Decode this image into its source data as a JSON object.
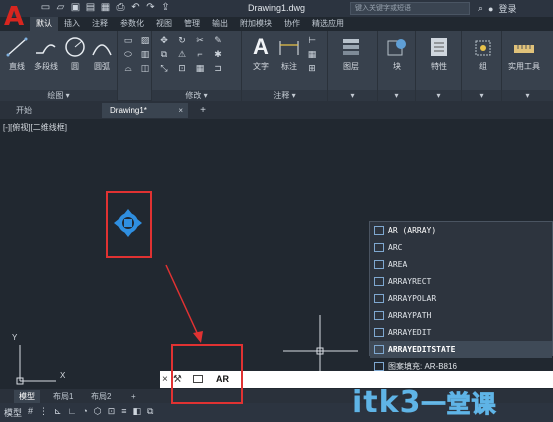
{
  "titlebar": {
    "app_logo": "A",
    "document_title": "Drawing1.dwg",
    "search_placeholder": "键入关键字或短语",
    "login_label": "登录",
    "qat_icons": [
      "new-icon",
      "open-icon",
      "save-icon",
      "saveas-icon",
      "print-icon",
      "undo-icon",
      "redo-icon"
    ]
  },
  "ribbon_tabs": [
    {
      "label": "默认",
      "active": true
    },
    {
      "label": "插入"
    },
    {
      "label": "注释"
    },
    {
      "label": "参数化"
    },
    {
      "label": "视图"
    },
    {
      "label": "管理"
    },
    {
      "label": "输出"
    },
    {
      "label": "附加模块"
    },
    {
      "label": "协作"
    },
    {
      "label": "精选应用"
    }
  ],
  "panels": {
    "draw": {
      "title": "绘图",
      "tools": [
        "直线",
        "多段线",
        "圆",
        "圆弧"
      ]
    },
    "modify": {
      "title": "修改"
    },
    "annotation": {
      "title": "注释",
      "tools": [
        "文字",
        "标注"
      ]
    },
    "layers": {
      "label": "图层"
    },
    "block": {
      "label": "块"
    },
    "properties": {
      "label": "特性"
    },
    "groups": {
      "label": "组"
    },
    "utilities": {
      "label": "实用工具"
    }
  },
  "file_tabs": {
    "start": "开始",
    "doc": "Drawing1*",
    "close_glyph": "×",
    "add_glyph": "+"
  },
  "drawing": {
    "view_label": "[-][俯视][二维线框]",
    "ucs_y": "Y",
    "ucs_x": "X"
  },
  "autocomplete": {
    "items": [
      {
        "label": "AR (ARRAY)",
        "kind": "head"
      },
      {
        "label": "ARC"
      },
      {
        "label": "AREA"
      },
      {
        "label": "ARRAYRECT"
      },
      {
        "label": "ARRAYPOLAR"
      },
      {
        "label": "ARRAYPATH"
      },
      {
        "label": "ARRAYEDIT"
      },
      {
        "label": "ARRAYEDITSTATE",
        "kind": "sel"
      },
      {
        "label": "图案填充: AR-B816",
        "kind": "hatch"
      }
    ]
  },
  "command_line": {
    "close_glyph": "×",
    "value": "AR"
  },
  "layout_tabs": [
    {
      "label": "模型",
      "active": true
    },
    {
      "label": "布局1"
    },
    {
      "label": "布局2"
    },
    {
      "label": "+"
    }
  ],
  "statusbar": {
    "model_label": "模型"
  },
  "watermark": {
    "text": "itk3",
    "cn": "一堂课"
  },
  "colors": {
    "canvas_bg": "#212830",
    "ribbon_bg": "#38414d",
    "annotation_red": "#e03232",
    "logo_red": "#d8261f",
    "watermark_blue": "#5fb4e6"
  }
}
